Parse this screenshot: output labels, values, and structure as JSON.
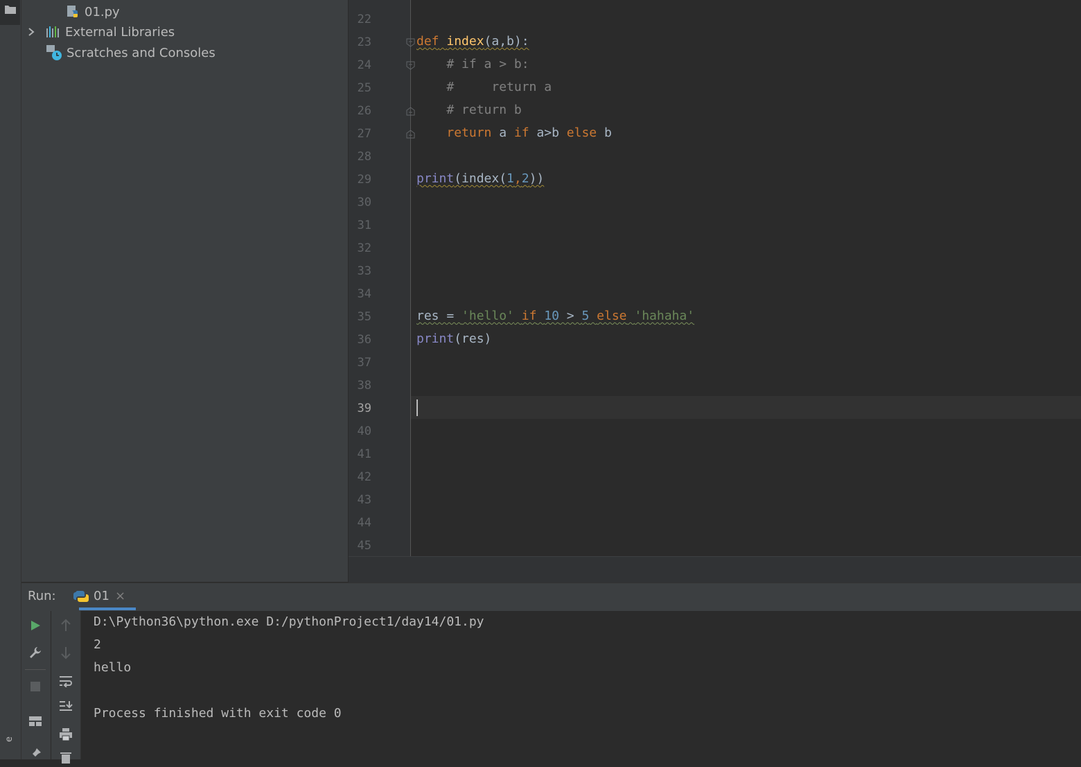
{
  "project_tree": [
    {
      "label": "01.py",
      "icon": "python-file-icon"
    },
    {
      "label": "External Libraries",
      "icon": "library-icon"
    },
    {
      "label": "Scratches and Consoles",
      "icon": "scratches-icon"
    }
  ],
  "editor": {
    "line_numbers": [
      "22",
      "23",
      "24",
      "25",
      "26",
      "27",
      "28",
      "29",
      "30",
      "31",
      "32",
      "33",
      "34",
      "35",
      "36",
      "37",
      "38",
      "39",
      "40",
      "41",
      "42",
      "43",
      "44",
      "45"
    ],
    "current_line": "39",
    "code": {
      "l23_def": "def",
      "l23_name": "index",
      "l23_args": "(a,b):",
      "l24": "    # if a > b:",
      "l25": "    #     return a",
      "l26": "    # return b",
      "l27_return": "return",
      "l27_a": " a ",
      "l27_if": "if",
      "l27_cond": " a>b ",
      "l27_else": "else",
      "l27_b": " b",
      "l29_print": "print",
      "l29_call": "(index(",
      "l29_n1": "1",
      "l29_comma": ",",
      "l29_n2": "2",
      "l29_close": "))",
      "l35_res": "res = ",
      "l35_s1": "'hello'",
      "l35_if": "if",
      "l35_n1": "10",
      "l35_gt": " > ",
      "l35_n2": "5",
      "l35_else": "else",
      "l35_s2": "'hahaha'",
      "l36_print": "print",
      "l36_args": "(res)"
    }
  },
  "run_panel": {
    "label": "Run:",
    "tab_label": "01",
    "tab_close": "×",
    "output": [
      "D:\\Python36\\python.exe D:/pythonProject1/day14/01.py",
      "2",
      "hello",
      "",
      "Process finished with exit code 0"
    ]
  },
  "side_text": "e",
  "colors": {
    "keyword": "#cc7832",
    "function": "#ffc66d",
    "builtin": "#8888c6",
    "number": "#6897bb",
    "string": "#6a8759",
    "comment": "#808080",
    "run_icon": "#59a869"
  }
}
